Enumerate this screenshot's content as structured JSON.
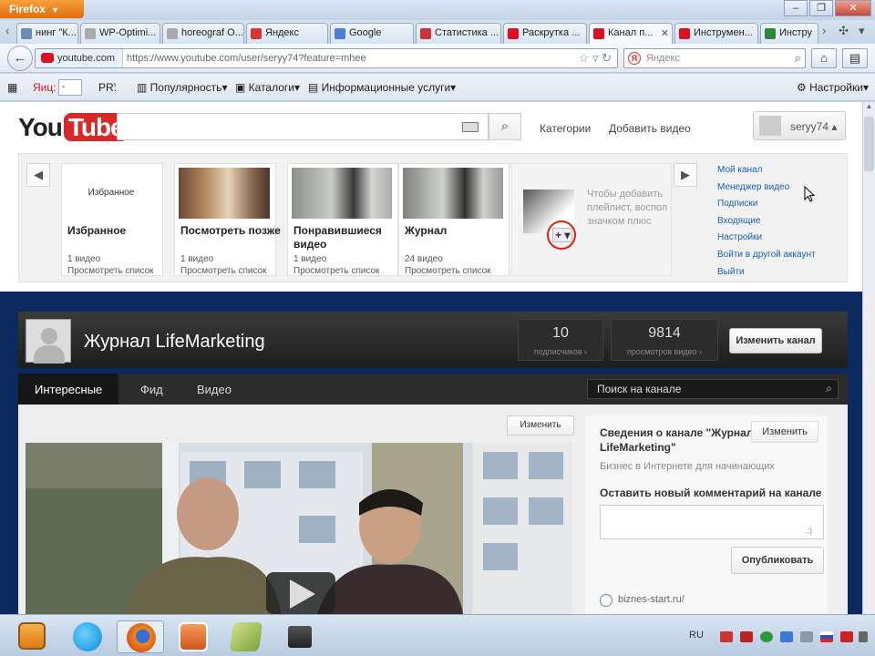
{
  "browser": {
    "menu_button": "Firefox",
    "tabs": [
      {
        "label": "нинг \"К...",
        "color": "#6a8bb6"
      },
      {
        "label": "WP-Optimi...",
        "color": "#888"
      },
      {
        "label": "horeograf O...",
        "color": "#888"
      },
      {
        "label": "Яндекс",
        "color": "#d33"
      },
      {
        "label": "Google",
        "color": "#4a7fd6"
      },
      {
        "label": "Статистика ...",
        "color": "#c33"
      },
      {
        "label": "Раскрутка ...",
        "color": "#d12"
      },
      {
        "label": "Канал п...",
        "color": "#d12"
      },
      {
        "label": "Инструмен...",
        "color": "#d12"
      },
      {
        "label": "Инстру",
        "color": "#2a8a3a"
      }
    ],
    "site_identity": "youtube.com",
    "url": "https://www.youtube.com/user/seryy74?feature=mhee",
    "search_placeholder": "Яндекс",
    "bookmarks": {
      "ya_label": "Яиц:",
      "ya_value": "-",
      "pr_label": "PR:",
      "pr_value": "-",
      "popularity": "Популярность",
      "catalogs": "Каталоги",
      "info_services": "Информационные услуги",
      "settings": "Настройки"
    }
  },
  "youtube": {
    "logo_you": "You",
    "logo_tube": "Tube",
    "nav_categories": "Категории",
    "nav_upload": "Добавить видео",
    "account_name": "seryy74",
    "playlists": [
      {
        "thumb_text": "Избранное",
        "title": "Избранное",
        "count": "1 видео",
        "link": "Просмотреть список"
      },
      {
        "thumb_text": "",
        "title": "Посмотреть позже",
        "count": "1 видео",
        "link": "Просмотреть список"
      },
      {
        "thumb_text": "",
        "title": "Понравившиеся видео",
        "count": "1 видео",
        "link": "Просмотреть список"
      },
      {
        "thumb_text": "",
        "title": "Журнал",
        "count": "24 видео",
        "link": "Просмотреть список"
      }
    ],
    "add_playlist_hint": "Чтобы добавить плейлист, воспол со значком плюс",
    "account_menu": [
      "Мой канал",
      "Менеджер видео",
      "Подписки",
      "Входящие",
      "Настройки",
      "Войти в другой аккаунт",
      "Выйти"
    ]
  },
  "channel": {
    "title": "Журнал LifeMarketing",
    "subscribers": {
      "value": "10",
      "label": "подписчиков ›"
    },
    "views": {
      "value": "9814",
      "label": "просмотров видео ›"
    },
    "edit_button": "Изменить канал",
    "tabs": [
      "Интересные",
      "Фид",
      "Видео"
    ],
    "search_placeholder": "Поиск на канале",
    "featured_edit": "Изменить",
    "about_title": "Сведения о канале \"Журнал LifeMarketing\"",
    "about_edit": "Изменить",
    "about_desc": "Бизнес в Интернете для начинающих",
    "comment_label": "Оставить новый комментарий на канале",
    "comment_grip": ".:|",
    "publish_button": "Опубликовать",
    "site_link": "biznes-start.ru/"
  },
  "taskbar": {
    "language": "RU",
    "apps": [
      "media-player",
      "skype",
      "firefox",
      "powerpoint-like",
      "notes",
      "video-recorder"
    ]
  },
  "colors": {
    "youtube_red": "#d62a2a",
    "channel_bg": "#0b2a5e",
    "link_blue": "#1b5fb0",
    "firefox_orange": "#e06d0c"
  }
}
